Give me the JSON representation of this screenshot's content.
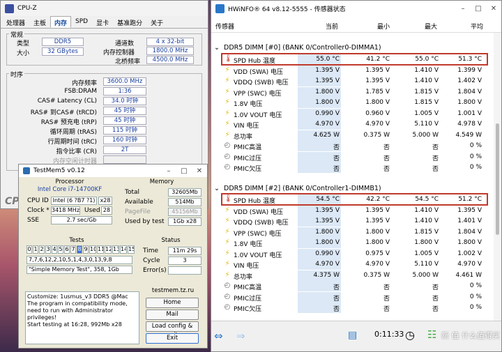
{
  "cpuz": {
    "title": "CPU-Z",
    "tabs": [
      "处理器",
      "主板",
      "内存",
      "SPD",
      "显卡",
      "基准跑分",
      "关于"
    ],
    "general_label": "常规",
    "type_label": "类型",
    "type_value": "DDR5",
    "size_label": "大小",
    "size_value": "32 GBytes",
    "channels_label": "通道数",
    "channels_value": "4 x 32-bit",
    "mc_label": "内存控制器",
    "mc_value": "1800.0 MHz",
    "nb_label": "北桥频率",
    "nb_value": "4500.0 MHz",
    "timing_label": "时序",
    "timings": [
      {
        "label": "内存频率",
        "value": "3600.0 MHz"
      },
      {
        "label": "FSB:DRAM",
        "value": "1:36"
      },
      {
        "label": "CAS# Latency (CL)",
        "value": "34.0 时钟"
      },
      {
        "label": "RAS# 到CAS# (tRCD)",
        "value": "45 时钟"
      },
      {
        "label": "RAS# 预充电 (tRP)",
        "value": "45 时钟"
      },
      {
        "label": "循环周期 (tRAS)",
        "value": "115 时钟"
      },
      {
        "label": "行周期时间 (tRC)",
        "value": "160 时钟"
      },
      {
        "label": "指令比率 (CR)",
        "value": "2T"
      },
      {
        "label": "内存空闲计时器",
        "value": ""
      }
    ],
    "logo": "CP"
  },
  "tm": {
    "title": "TestMem5 v0.12",
    "processor_label": "Processor",
    "cpu_model": "Intel Core i7-14700KF",
    "cpuid_label": "CPU ID",
    "cpuid_value": "Intel (6 ?B7 ?1)",
    "threads": "x28",
    "clock_label": "Clock *",
    "clock_value": "3418 MHz",
    "used_label": "Used",
    "used_value": "28",
    "sse_label": "SSE",
    "sse_value": "2.7 sec/Gb",
    "memory_label": "Memory",
    "total_label": "Total",
    "total_value": "32605Mb",
    "avail_label": "Available",
    "avail_value": "514Mb",
    "pagefile_label": "PageFile",
    "pagefile_value": "45156Mb",
    "usedby_label": "Used by test",
    "usedby_value": "1Gb x28",
    "tests_label": "Tests",
    "tests": [
      "0",
      "1",
      "2",
      "3",
      "4",
      "5",
      "6",
      "7",
      "8",
      "9",
      "10",
      "11",
      "12",
      "13",
      "14",
      "15"
    ],
    "test_active": 8,
    "sequence": "7,7,6,12,2,10,5,1,4,3,0,13,9,8",
    "current_test": "\"Simple Memory Test\", 358, 1Gb",
    "status_label": "Status",
    "time_label": "Time",
    "time_value": "11m 29s",
    "cycle_label": "Cycle",
    "cycle_value": "3",
    "errors_label": "Error(s)",
    "errors_value": "",
    "log": "Customize: 1usmus_v3 DDR5 @Mac\nThe program in compatibility mode,\nneed to run with Administrator privileges!\nStart testing at 16:28, 992Mb x28",
    "site": "testmem.tz.ru",
    "buttons": [
      "Home",
      "Mail",
      "Load config & exit",
      "Exit"
    ]
  },
  "hw": {
    "title": "HWiNFO® 64 v8.12-5555 - 传感器状态",
    "headers": [
      "传感器",
      "当前",
      "最小",
      "最大",
      "平均"
    ],
    "sec1": "DDR5 DIMM [#0] (BANK 0/Controller0-DIMMA1)",
    "rows1": [
      {
        "icon": "thermometer-icon",
        "name": "SPD Hub 温度",
        "cur": "55.0 °C",
        "min": "41.2 °C",
        "max": "55.0 °C",
        "avg": "51.3 °C"
      },
      {
        "icon": "bolt-icon",
        "name": "VDD (SWA) 电压",
        "cur": "1.395 V",
        "min": "1.395 V",
        "max": "1.410 V",
        "avg": "1.399 V"
      },
      {
        "icon": "bolt-icon",
        "name": "VDDQ (SWB) 电压",
        "cur": "1.395 V",
        "min": "1.395 V",
        "max": "1.410 V",
        "avg": "1.402 V"
      },
      {
        "icon": "bolt-icon",
        "name": "VPP (SWC) 电压",
        "cur": "1.800 V",
        "min": "1.785 V",
        "max": "1.815 V",
        "avg": "1.804 V"
      },
      {
        "icon": "bolt-icon",
        "name": "1.8V 电压",
        "cur": "1.800 V",
        "min": "1.800 V",
        "max": "1.815 V",
        "avg": "1.800 V"
      },
      {
        "icon": "bolt-icon",
        "name": "1.0V VOUT 电压",
        "cur": "0.990 V",
        "min": "0.960 V",
        "max": "1.005 V",
        "avg": "1.001 V"
      },
      {
        "icon": "bolt-icon",
        "name": "VIN 电压",
        "cur": "4.970 V",
        "min": "4.970 V",
        "max": "5.110 V",
        "avg": "4.978 V"
      },
      {
        "icon": "bolt-icon",
        "name": "总功率",
        "cur": "4.625 W",
        "min": "0.375 W",
        "max": "5.000 W",
        "avg": "4.549 W"
      },
      {
        "icon": "clock-icon",
        "name": "PMIC高温",
        "cur": "否",
        "min": "否",
        "max": "否",
        "avg": "0 %"
      },
      {
        "icon": "clock-icon",
        "name": "PMIC过压",
        "cur": "否",
        "min": "否",
        "max": "否",
        "avg": "0 %"
      },
      {
        "icon": "clock-icon",
        "name": "PMIC欠压",
        "cur": "否",
        "min": "否",
        "max": "否",
        "avg": "0 %"
      }
    ],
    "sec2": "DDR5 DIMM [#2] (BANK 0/Controller1-DIMMB1)",
    "rows2": [
      {
        "icon": "thermometer-icon",
        "name": "SPD Hub 温度",
        "cur": "54.5 °C",
        "min": "42.2 °C",
        "max": "54.5 °C",
        "avg": "51.2 °C"
      },
      {
        "icon": "bolt-icon",
        "name": "VDD (SWA) 电压",
        "cur": "1.395 V",
        "min": "1.395 V",
        "max": "1.410 V",
        "avg": "1.395 V"
      },
      {
        "icon": "bolt-icon",
        "name": "VDDQ (SWB) 电压",
        "cur": "1.395 V",
        "min": "1.395 V",
        "max": "1.410 V",
        "avg": "1.401 V"
      },
      {
        "icon": "bolt-icon",
        "name": "VPP (SWC) 电压",
        "cur": "1.800 V",
        "min": "1.800 V",
        "max": "1.815 V",
        "avg": "1.804 V"
      },
      {
        "icon": "bolt-icon",
        "name": "1.8V 电压",
        "cur": "1.800 V",
        "min": "1.800 V",
        "max": "1.800 V",
        "avg": "1.800 V"
      },
      {
        "icon": "bolt-icon",
        "name": "1.0V VOUT 电压",
        "cur": "0.990 V",
        "min": "0.975 V",
        "max": "1.005 V",
        "avg": "1.002 V"
      },
      {
        "icon": "bolt-icon",
        "name": "VIN 电压",
        "cur": "4.970 V",
        "min": "4.970 V",
        "max": "5.110 V",
        "avg": "4.970 V"
      },
      {
        "icon": "bolt-icon",
        "name": "总功率",
        "cur": "4.375 W",
        "min": "0.375 W",
        "max": "5.000 W",
        "avg": "4.461 W"
      },
      {
        "icon": "clock-icon",
        "name": "PMIC高温",
        "cur": "否",
        "min": "否",
        "max": "否",
        "avg": "0 %"
      },
      {
        "icon": "clock-icon",
        "name": "PMIC过压",
        "cur": "否",
        "min": "否",
        "max": "否",
        "avg": "0 %"
      },
      {
        "icon": "clock-icon",
        "name": "PMIC欠压",
        "cur": "否",
        "min": "否",
        "max": "否",
        "avg": "0 %"
      }
    ],
    "elapsed": "0:11:33",
    "watermark": "新 值 什么值得买"
  }
}
